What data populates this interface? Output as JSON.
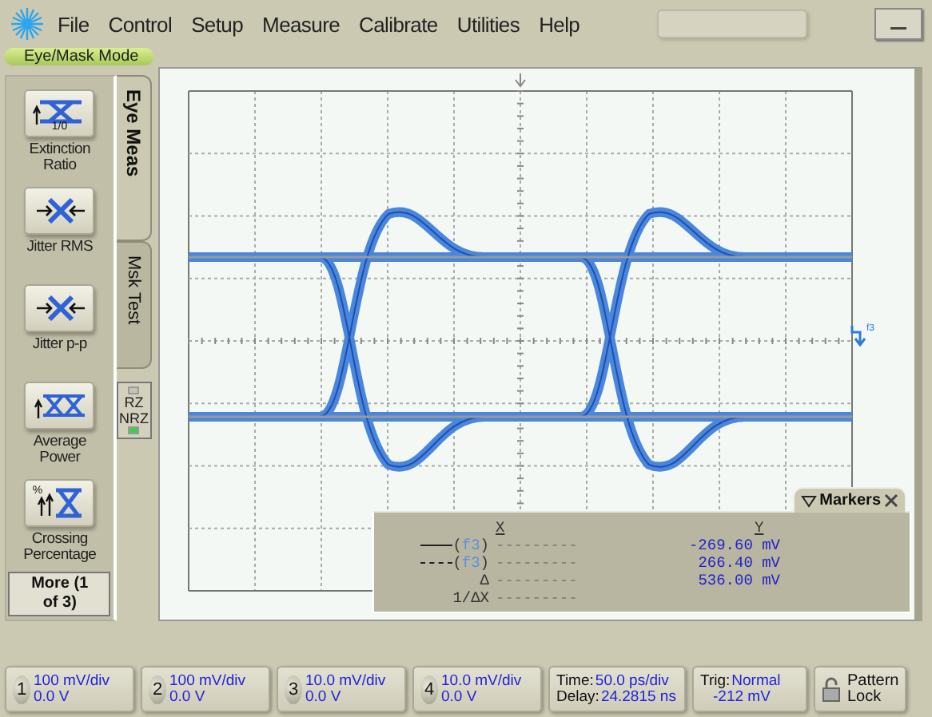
{
  "menu": [
    {
      "label": "File"
    },
    {
      "label": "Control"
    },
    {
      "label": "Setup"
    },
    {
      "label": "Measure"
    },
    {
      "label": "Calibrate"
    },
    {
      "label": "Utilities"
    },
    {
      "label": "Help"
    }
  ],
  "mode_label": "Eye/Mask Mode",
  "measurements": [
    {
      "kind": "extinction",
      "label": "Extinction Ratio",
      "icon_text": "1/0"
    },
    {
      "kind": "jitter_rms",
      "label": "Jitter RMS"
    },
    {
      "kind": "jitter_pp",
      "label": "Jitter p-p"
    },
    {
      "kind": "avg_power",
      "label": "Average Power"
    },
    {
      "kind": "crossing",
      "label": "Crossing Percentage",
      "icon_text": "%"
    }
  ],
  "more_button": "More (1 of 3)",
  "tabs": [
    {
      "label": "Eye Meas",
      "selected": true
    },
    {
      "label": "Msk Test",
      "selected": false
    }
  ],
  "pattern_modes": [
    {
      "label": "RZ",
      "on": false
    },
    {
      "label": "NRZ",
      "on": true
    }
  ],
  "marker_tag": "f3",
  "markers": {
    "title": "Markers",
    "columns": [
      "X",
      "Y"
    ],
    "rows": [
      {
        "kind": "solid",
        "open": "(",
        "source": "f3",
        "close": ")",
        "x": "---------",
        "y": "-269.60 mV"
      },
      {
        "kind": "dashed",
        "open": "(",
        "source": "f3",
        "close": ")",
        "x": "---------",
        "y": "266.40 mV"
      },
      {
        "kind": "text",
        "label": "Δ",
        "x": "---------",
        "y": "536.00 mV"
      },
      {
        "kind": "text",
        "label": "1/ΔX",
        "x": "---------"
      }
    ]
  },
  "channels": [
    {
      "number": "1",
      "scale": "100 mV/div",
      "offset": "0.0 V"
    },
    {
      "number": "2",
      "scale": "100 mV/div",
      "offset": "0.0 V"
    },
    {
      "number": "3",
      "scale": "10.0 mV/div",
      "offset": "0.0 V"
    },
    {
      "number": "4",
      "scale": "10.0 mV/div",
      "offset": "0.0 V"
    }
  ],
  "timebase": {
    "label": "Time:",
    "value": "50.0 ps/div",
    "delay_label": "Delay:",
    "delay": "24.2815 ns"
  },
  "trigger": {
    "label": "Trig:",
    "mode": "Normal",
    "trigger_level": "-212 mV"
  },
  "pattern_lock": "Pattern Lock"
}
